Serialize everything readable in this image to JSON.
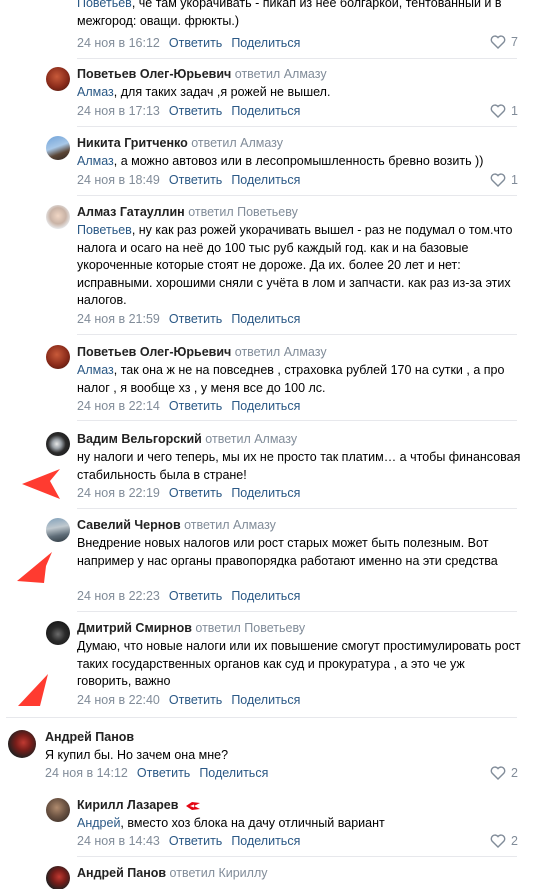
{
  "comments": [
    {
      "text_prefix": "Поветьев",
      "text_body": ", чё там укорачивать - пикап из неё болгаркой, тентованный и в межгород: оващи. фрюкты.)",
      "date": "24 ноя в 16:12",
      "reply_label": "Ответить",
      "share_label": "Поделиться",
      "likes": "7"
    },
    {
      "author": "Поветьев Олег-Юрьевич",
      "reply_to": "ответил Алмазу",
      "text_prefix": "Алмаз",
      "text_body": ", для таких задач ,я рожей не вышел.",
      "date": "24 ноя в 17:13",
      "reply_label": "Ответить",
      "share_label": "Поделиться",
      "likes": "1"
    },
    {
      "author": "Никита Гритченко",
      "reply_to": "ответил Алмазу",
      "text_prefix": "Алмаз",
      "text_body": ", а можно автовоз или в лесопромышленность бревно возить ))",
      "date": "24 ноя в 18:49",
      "reply_label": "Ответить",
      "share_label": "Поделиться",
      "likes": "1"
    },
    {
      "author": "Алмаз Гатауллин",
      "reply_to": "ответил Поветьеву",
      "text_prefix": "Поветьев",
      "text_body": ", ну как раз рожей укорачивать вышел - раз не подумал о том.что налога и осаго на неё до 100 тыс руб каждый год. как и на базовые укороченные которые стоят не дороже. Да их. более 20 лет и нет: исправными. хорошими сняли с учёта в лом и запчасти. как раз из-за этих налогов.",
      "date": "24 ноя в 21:59",
      "reply_label": "Ответить",
      "share_label": "Поделиться"
    },
    {
      "author": "Поветьев Олег-Юрьевич",
      "reply_to": "ответил Алмазу",
      "text_prefix": "Алмаз",
      "text_body": ", так она ж не на повседнев , страховка рублей 170 на сутки , а про налог , я вообще хз , у меня все до 100 лс.",
      "date": "24 ноя в 22:14",
      "reply_label": "Ответить",
      "share_label": "Поделиться"
    },
    {
      "author": "Вадим Вельгорский",
      "reply_to": "ответил Алмазу",
      "text_body": "ну налоги и чего теперь, мы их не просто так платим… а чтобы финансовая стабильность была в стране!",
      "date": "24 ноя в 22:19",
      "reply_label": "Ответить",
      "share_label": "Поделиться"
    },
    {
      "author": "Савелий Чернов",
      "reply_to": "ответил Алмазу",
      "text_body": "Внедрение новых налогов или рост старых может быть полезным. Вот например у нас органы правопорядка работают именно на эти средства",
      "date": "24 ноя в 22:23",
      "reply_label": "Ответить",
      "share_label": "Поделиться"
    },
    {
      "author": "Дмитрий Смирнов",
      "reply_to": "ответил Поветьеву",
      "text_body": "Думаю, что новые налоги или их повышение смогут простимулировать рост таких государственных органов как суд и прокуратура , а это че уж говорить, важно",
      "date": "24 ноя в 22:40",
      "reply_label": "Ответить",
      "share_label": "Поделиться"
    },
    {
      "author": "Андрей Панов",
      "text_body": "Я купил бы. Но зачем она мне?",
      "date": "24 ноя в 14:12",
      "reply_label": "Ответить",
      "share_label": "Поделиться",
      "likes": "2"
    },
    {
      "author": "Кирилл Лазарев",
      "text_prefix": "Андрей",
      "text_body": ", вместо хоз блока на дачу отличный вариант",
      "date": "24 ноя в 14:43",
      "reply_label": "Ответить",
      "share_label": "Поделиться",
      "likes": "2"
    },
    {
      "author": "Андрей Панов",
      "reply_to": "ответил Кириллу"
    }
  ],
  "icons": {
    "like": "heart-outline-icon",
    "arrow": "red-arrow-icon",
    "badge": "spartak-badge-icon"
  },
  "colors": {
    "link": "#2a5885",
    "meta": "#818c99",
    "arrow": "#ff3b30",
    "separator": "#e7e8ec"
  }
}
